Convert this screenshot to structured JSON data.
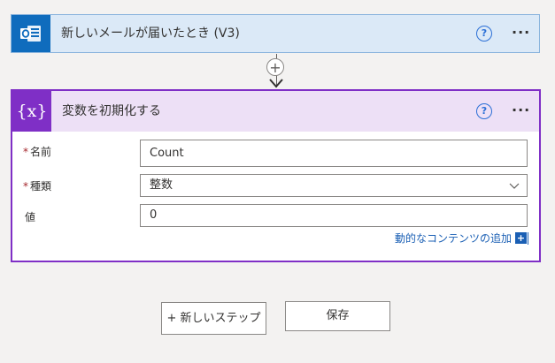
{
  "trigger": {
    "title": "新しいメールが届いたとき (V3)",
    "help": "?",
    "more": "···",
    "icon": "outlook-icon"
  },
  "connector": {
    "add": "+"
  },
  "action": {
    "title": "変数を初期化する",
    "icon_text": "{x}",
    "help": "?",
    "more": "···",
    "fields": {
      "name": {
        "required": "*",
        "label": "名前",
        "value": "Count"
      },
      "type": {
        "required": "*",
        "label": "種類",
        "value": "整数"
      },
      "value": {
        "label": "値",
        "value": "0"
      }
    },
    "dynamic_content": {
      "label": "動的なコンテンツの追加",
      "plus": "+"
    }
  },
  "footer": {
    "new_step": "+ 新しいステップ",
    "save": "保存"
  },
  "colors": {
    "trigger_accent": "#0f6cbd",
    "trigger_bg": "#dbe9f7",
    "action_accent": "#7f2fc6",
    "action_header_bg": "#ede0f6",
    "link": "#1a5fb4",
    "required": "#a4262c"
  }
}
